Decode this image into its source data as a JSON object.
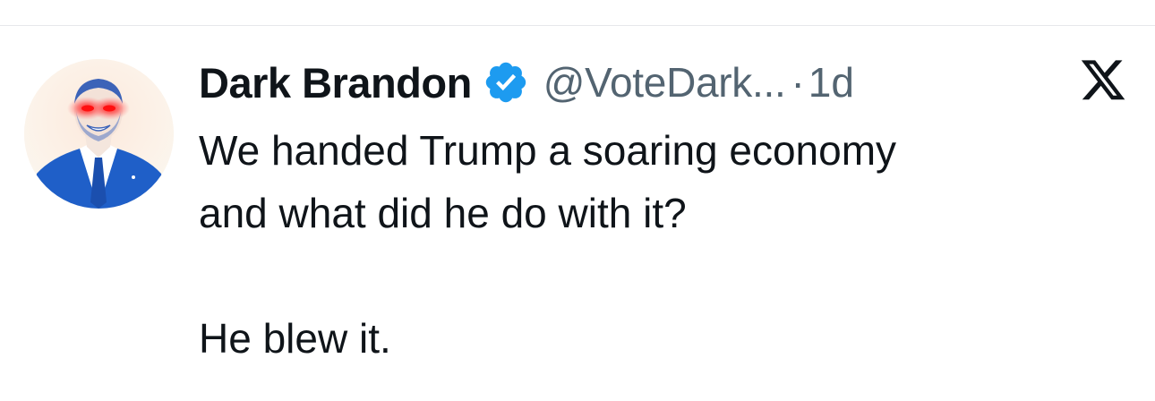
{
  "tweet": {
    "author": {
      "display_name": "Dark Brandon",
      "handle": "@VoteDark...",
      "verified": true,
      "avatar_icon": "dark-brandon-avatar"
    },
    "separator": "·",
    "time": "1d",
    "platform_icon": "x-logo-icon",
    "text_paragraphs": [
      [
        "We handed Trump a soaring economy",
        "and what did he do with it?"
      ],
      [
        "He blew it."
      ]
    ]
  },
  "colors": {
    "text": "#0f1419",
    "secondary": "#536471",
    "verified_blue": "#1d9bf0",
    "avatar_blue": "#1f5fc8",
    "laser_red": "#ff2a2a"
  }
}
